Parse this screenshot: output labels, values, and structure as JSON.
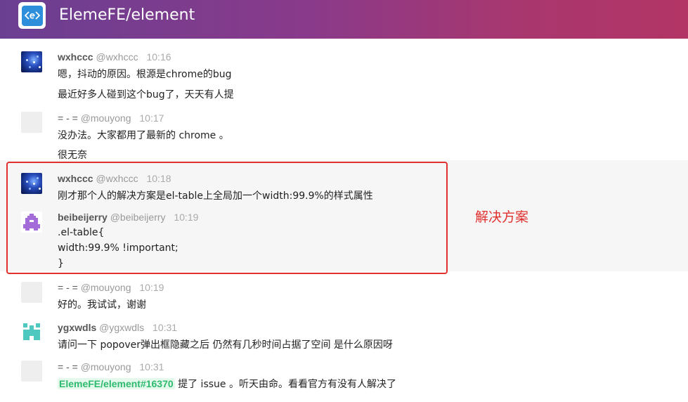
{
  "header": {
    "room_title": "ElemeFE/element",
    "logo_glyph": "<e>",
    "gradient": [
      "#6a3f92",
      "#b23565"
    ]
  },
  "messages": [
    {
      "name": "wxhccc",
      "handle": "@wxhccc",
      "time": "10:16",
      "avatar": "space-avatar",
      "lines": [
        "嗯，抖动的原因。根源是chrome的bug",
        "最近好多人碰到这个bug了，天天有人提"
      ]
    },
    {
      "name": "= - =",
      "handle": "@mouyong",
      "time": "10:17",
      "avatar": "blank-avatar",
      "lines": [
        "没办法。大家都用了最新的 chrome 。",
        "很无奈"
      ]
    },
    {
      "name": "wxhccc",
      "handle": "@wxhccc",
      "time": "10:18",
      "avatar": "space-avatar",
      "lines": [
        "刚才那个人的解决方案是el-table上全局加一个width:99.9%的样式属性"
      ]
    },
    {
      "name": "beibeijerry",
      "handle": "@beibeijerry",
      "time": "10:19",
      "avatar": "pixel-avatar-purple",
      "lines": [
        ".el-table{",
        "width:99.9% !important;",
        "}"
      ]
    },
    {
      "name": "= - =",
      "handle": "@mouyong",
      "time": "10:19",
      "avatar": "blank-avatar",
      "lines": [
        "好的。我试试，谢谢"
      ]
    },
    {
      "name": "ygxwdls",
      "handle": "@ygxwdls",
      "time": "10:31",
      "avatar": "pixel-avatar-teal",
      "lines": [
        "请问一下 popover弹出框隐藏之后 仍然有几秒时间占据了空间 是什么原因呀"
      ]
    },
    {
      "name": "= - =",
      "handle": "@mouyong",
      "time": "10:31",
      "avatar": "blank-avatar",
      "issue_link": "ElemeFE/element#16370",
      "line_after_link": " 提了 issue 。听天由命。看看官方有没有人解决了"
    }
  ],
  "annotation": {
    "text": "解决方案",
    "color": "#e0312f"
  }
}
